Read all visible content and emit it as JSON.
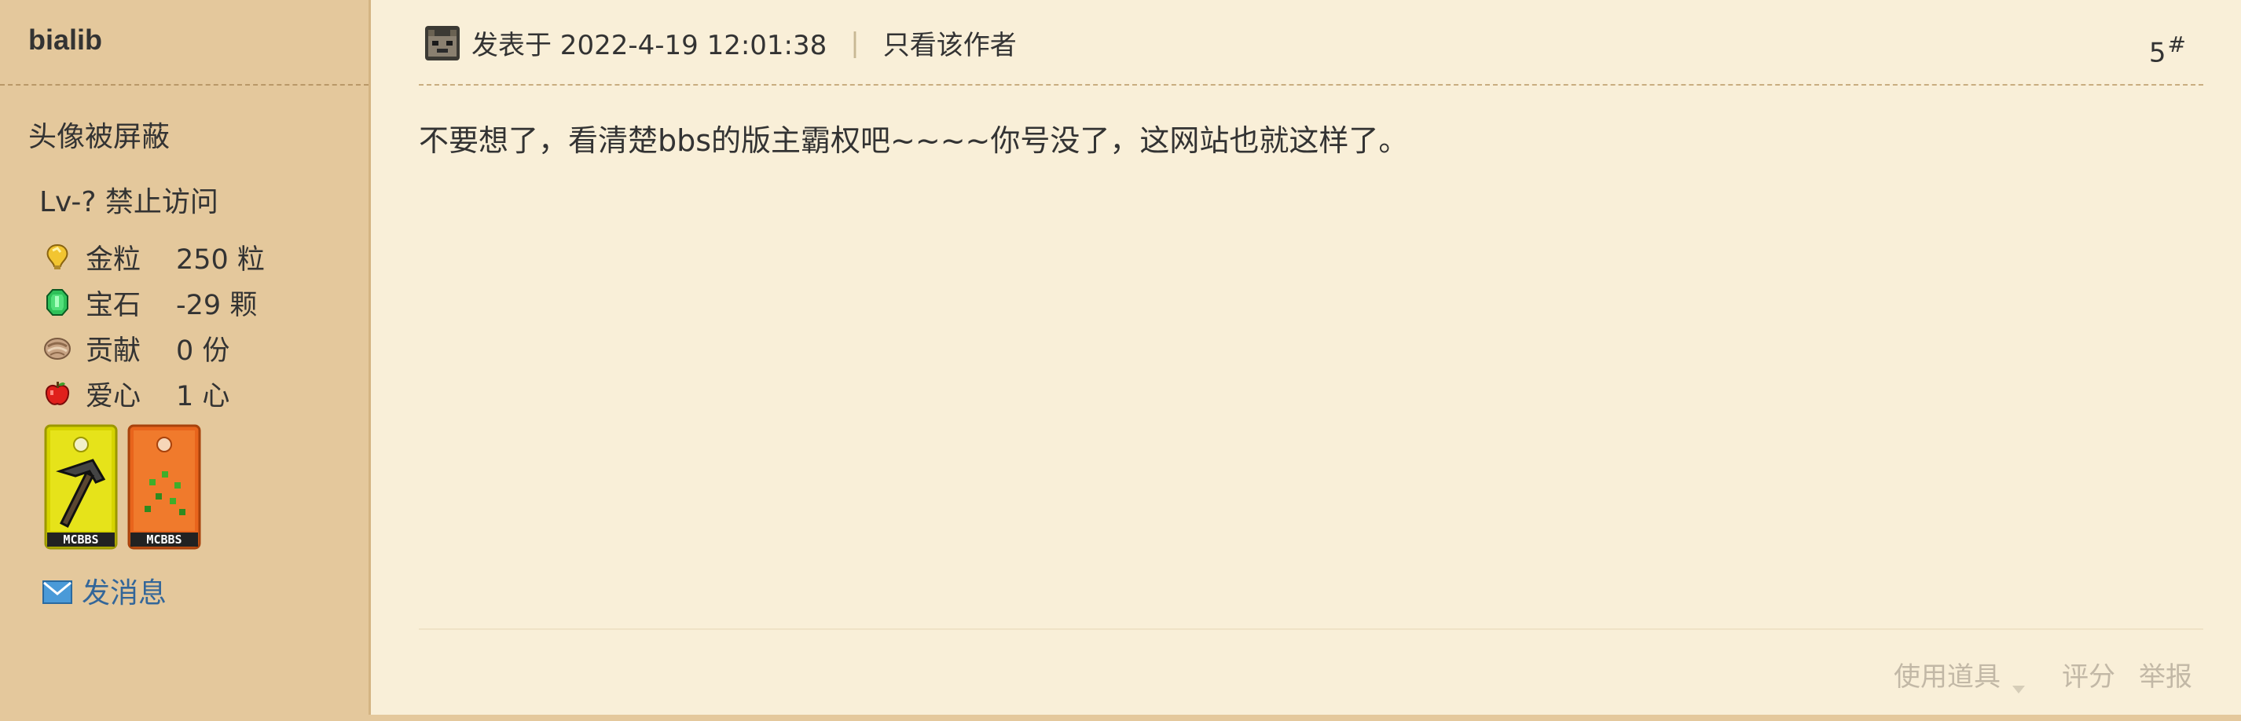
{
  "sidebar": {
    "username": "bialib",
    "avatar_text": "头像被屏蔽",
    "level": "Lv-? 禁止访问",
    "stats": [
      {
        "icon": "gold-nugget-icon",
        "label": "金粒",
        "value": "250 粒"
      },
      {
        "icon": "emerald-icon",
        "label": "宝石",
        "value": "-29 颗"
      },
      {
        "icon": "contribution-icon",
        "label": "贡献",
        "value": "0 份"
      },
      {
        "icon": "apple-icon",
        "label": "爱心",
        "value": "1 心"
      }
    ],
    "medals": [
      {
        "icon": "pickaxe-medal-icon",
        "text": "MCBBS",
        "color": "#d6d400"
      },
      {
        "icon": "seeds-medal-icon",
        "text": "MCBBS",
        "color": "#e8641c"
      }
    ],
    "send_message": "发消息"
  },
  "post": {
    "posted_at": "发表于 2022-4-19 12:01:38",
    "only_author": "只看该作者",
    "floor": "5",
    "floor_symbol": "#",
    "content": "不要想了，看清楚bbs的版主霸权吧~~~~你号没了，这网站也就这样了。",
    "actions": {
      "use_tool": "使用道具",
      "rate": "评分",
      "report": "举报"
    }
  },
  "colors": {
    "page_bg": "#f9efd8",
    "sidebar_bg": "#e4c89c",
    "link": "#336699",
    "muted": "#c2b8a6"
  }
}
